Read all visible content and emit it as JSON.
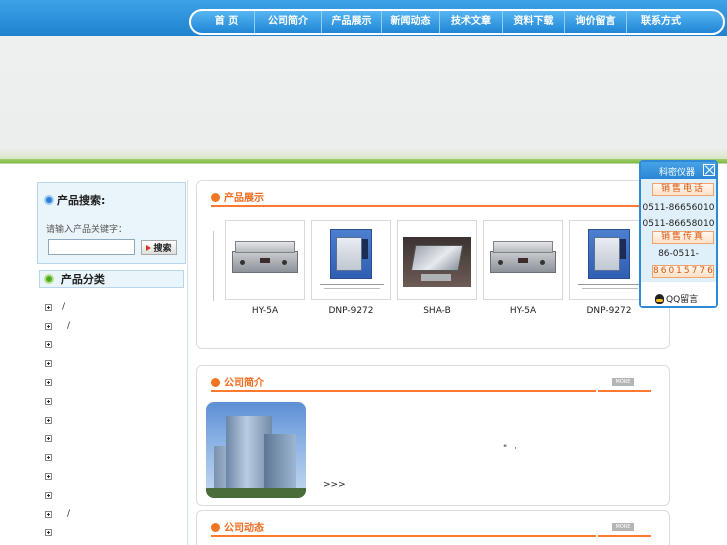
{
  "nav": {
    "items": [
      "首 页",
      "公司简介",
      "产品展示",
      "新闻动态",
      "技术文章",
      "资料下载",
      "询价留言",
      "联系方式"
    ]
  },
  "sidebar": {
    "search_title": "产品搜索:",
    "search_hint": "请输入产品关键字：",
    "search_input_value": "",
    "search_button": "搜索",
    "category_title": "产品分类",
    "categories": [
      "/",
      "/",
      "",
      "",
      "",
      "",
      "",
      "",
      "",
      "",
      "",
      "/",
      ""
    ]
  },
  "products_section": {
    "title": "产品展示",
    "items": [
      {
        "name": "HY-5A",
        "icon": "oscillator-photo"
      },
      {
        "name": "DNP-9272",
        "icon": "incubator-photo"
      },
      {
        "name": "SHA-B",
        "icon": "water-bath-shaker-photo"
      },
      {
        "name": "HY-5A",
        "icon": "oscillator-photo"
      },
      {
        "name": "DNP-9272",
        "icon": "incubator-photo"
      }
    ]
  },
  "company_section": {
    "title": "公司简介",
    "more_label": "MORE",
    "marks": "\" ·",
    "more_link": ">>>"
  },
  "news_section": {
    "title": "公司动态",
    "more_label": "MORE"
  },
  "contact_widget": {
    "title": "科密仪器",
    "sales_phone_label": "销售电话",
    "phones": [
      "0511-86656010",
      "0511-86658010"
    ],
    "fax_label": "销售传真",
    "fax_line1": "86-0511-",
    "fax_line2": "86015776",
    "qq_label": "QQ留言"
  },
  "colors": {
    "nav_blue": "#1e82cf",
    "accent_orange": "#f06a1d",
    "banner_green": "#7fba44"
  }
}
